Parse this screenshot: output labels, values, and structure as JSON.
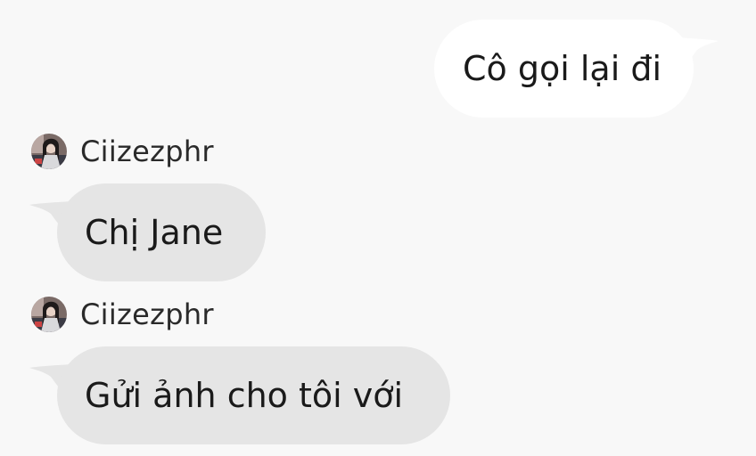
{
  "messages": [
    {
      "direction": "outgoing",
      "text": "Cô gọi lại đi"
    },
    {
      "direction": "incoming",
      "sender": "Ciizezphr",
      "text": "Chị Jane"
    },
    {
      "direction": "incoming",
      "sender": "Ciizezphr",
      "text": "Gửi ảnh cho tôi với"
    }
  ],
  "colors": {
    "background": "#f8f8f8",
    "outgoing_bubble": "#ffffff",
    "incoming_bubble": "#e5e5e5",
    "text": "#1a1a1a"
  },
  "icons": {
    "avatar": "user-avatar-photo"
  }
}
